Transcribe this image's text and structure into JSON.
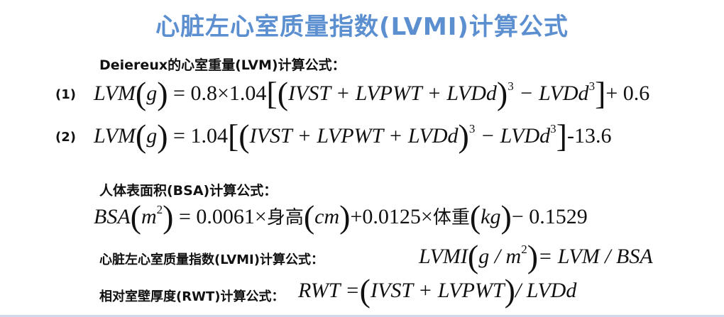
{
  "title": "心脏左心室质量指数(LVMI)计算公式",
  "sections": {
    "devereux_label": "Deiereux的心室重量(LVM)计算公式：",
    "formula1_index": "(1)",
    "formula2_index": "(2)",
    "bsa_label": "人体表面积(BSA)计算公式：",
    "lvmi_label": "心脏左心室质量指数(LVMI)计算公式：",
    "rwt_label": "相对室壁厚度(RWT)计算公式："
  },
  "formulas": {
    "f1": {
      "lhs": "LVM",
      "unit": "g",
      "coef": "= 0.8×1.04",
      "inner": "IVST + LVPWT + LVDd",
      "cube": "3",
      "minus": "− LVDd",
      "tail": "+ 0.6"
    },
    "f2": {
      "lhs": "LVM",
      "unit": "g",
      "coef": "= 1.04",
      "inner": "IVST + LVPWT + LVDd",
      "cube": "3",
      "minus": "− LVDd",
      "tail": "-13.6"
    },
    "bsa": {
      "lhs": "BSA",
      "unit": "m",
      "sq": "2",
      "c1": "= 0.0061×",
      "w1": "身高",
      "u1": "cm",
      "c2": "+0.0125×",
      "w2": "体重",
      "u2": "kg",
      "tail": "− 0.1529"
    },
    "lvmi": {
      "lhs": "LVMI",
      "unit": "g / m",
      "sq": "2",
      "rhs": "= LVM / BSA"
    },
    "rwt": {
      "lhs": "RWT =",
      "inner": "IVST + LVPWT",
      "rhs": "/ LVDd"
    }
  }
}
